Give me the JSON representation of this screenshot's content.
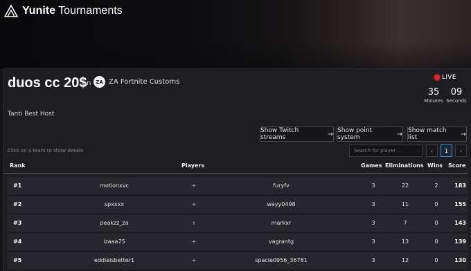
{
  "header": {
    "brand_bold": "Yunite",
    "brand_rest": " Tournaments"
  },
  "tournament": {
    "title": "duos cc 20$",
    "on_label": "on",
    "org_logo_text": "ZA",
    "org_name": "ZA Fortnite Customs",
    "host": "Tanti Best Host",
    "live_label": "LIVE",
    "countdown": {
      "minutes": "35",
      "minutes_label": "Minutes",
      "seconds": "09",
      "seconds_label": "Seconds"
    }
  },
  "actions": {
    "twitch": "Show Twitch streams",
    "points": "Show point system",
    "matches": "Show match list",
    "arrow": "→"
  },
  "table_controls": {
    "hint": "Click on a team to show details",
    "search_placeholder": "Search for player ...",
    "prev": "‹",
    "page": "1",
    "next": "›"
  },
  "table": {
    "headers": {
      "rank": "Rank",
      "players": "Players",
      "games": "Games",
      "eliminations": "Eliminations",
      "wins": "Wins",
      "score": "Score"
    },
    "rows": [
      {
        "rank": "#1",
        "p1": "motionxvc",
        "plus": "+",
        "p2": "furyfv",
        "games": "3",
        "elims": "22",
        "wins": "2",
        "score": "183"
      },
      {
        "rank": "#2",
        "p1": "spxxxx",
        "plus": "+",
        "p2": "wayy0498",
        "games": "3",
        "elims": "11",
        "wins": "0",
        "score": "155"
      },
      {
        "rank": "#3",
        "p1": "peakzz_za",
        "plus": "+",
        "p2": "markxr",
        "games": "3",
        "elims": "7",
        "wins": "0",
        "score": "143"
      },
      {
        "rank": "#4",
        "p1": "izaaa75",
        "plus": "+",
        "p2": "vagrantg",
        "games": "3",
        "elims": "13",
        "wins": "0",
        "score": "139"
      },
      {
        "rank": "#5",
        "p1": "eddieisbetter1",
        "plus": "+",
        "p2": "spacie0956_36781",
        "games": "3",
        "elims": "12",
        "wins": "0",
        "score": "130"
      }
    ]
  },
  "colors": {
    "live": "#e0262b",
    "accent": "#3f8fd1",
    "row_bg": "#26262c",
    "panel_bg": "#1d1d22"
  }
}
